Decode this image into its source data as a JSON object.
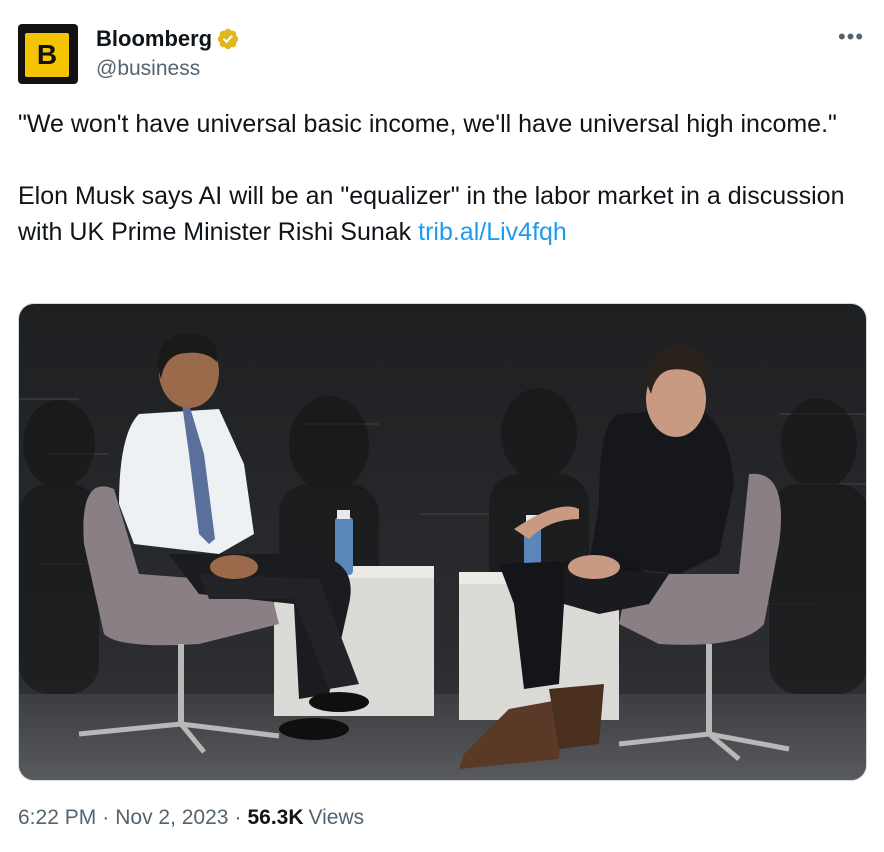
{
  "author": {
    "name": "Bloomberg",
    "handle": "@business",
    "avatar_letter": "B",
    "verified_icon": "gold-verified-badge-icon",
    "verified_color": "#e2b719"
  },
  "more_icon_glyph": "•••",
  "tweet": {
    "quote": "\"We won't have universal basic income, we'll have universal high income.\"",
    "body": "Elon Musk says AI will be an \"equalizer\" in the labor market in a discussion with UK Prime Minister Rishi Sunak ",
    "link_text": "trib.al/Liv4fqh"
  },
  "meta": {
    "time": "6:22 PM",
    "separator": "·",
    "date": "Nov 2, 2023",
    "views_count": "56.3K",
    "views_label": "Views"
  },
  "colors": {
    "link": "#1d9bf0",
    "secondary_text": "#536471",
    "avatar_bg": "#f5c400"
  }
}
